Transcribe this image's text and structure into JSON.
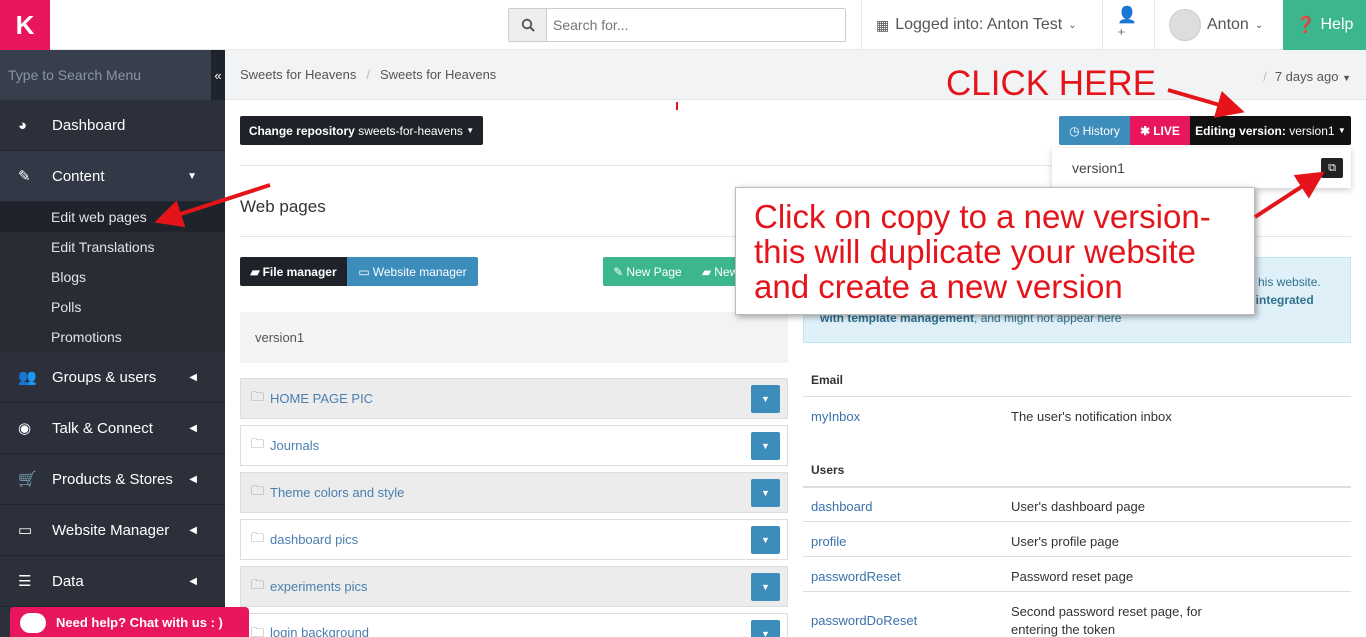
{
  "topbar": {
    "logo": "K",
    "search_placeholder": "Search for...",
    "logged_into": "Logged into: Anton Test",
    "user": "Anton",
    "help": "Help"
  },
  "sidebar": {
    "search_placeholder": "Type to Search Menu",
    "collapse": "«",
    "items": [
      {
        "label": "Dashboard",
        "icon": "dashboard-icon"
      },
      {
        "label": "Content",
        "icon": "edit-icon"
      },
      {
        "label": "Groups & users",
        "icon": "users-icon"
      },
      {
        "label": "Talk & Connect",
        "icon": "rss-icon"
      },
      {
        "label": "Products & Stores",
        "icon": "cart-icon"
      },
      {
        "label": "Website Manager",
        "icon": "monitor-icon"
      },
      {
        "label": "Data",
        "icon": "database-icon"
      }
    ],
    "content_sub": [
      "Edit web pages",
      "Edit Translations",
      "Blogs",
      "Polls",
      "Promotions"
    ]
  },
  "breadcrumb": {
    "items": [
      "Sweets for Heavens",
      "Sweets for Heavens"
    ],
    "ago": "7 days ago"
  },
  "toolbar": {
    "change_repo_prefix": "Change repository",
    "change_repo_value": "sweets-for-heavens",
    "history": "History",
    "live": "LIVE",
    "editing_prefix": "Editing version:",
    "editing_value": "version1"
  },
  "version_dropdown": {
    "item": "version1"
  },
  "main": {
    "title": "Web pages",
    "file_manager": "File manager",
    "website_manager": "Website manager",
    "new_page": "New Page",
    "new_folder": "New",
    "repo_label": "version1",
    "folders": [
      "HOME PAGE PIC",
      "Journals",
      "Theme colors and style",
      "dashboard pics",
      "experiments pics",
      "login background"
    ]
  },
  "info": {
    "line1": "his website.",
    "line2": "re integrated",
    "line3a": "with template management",
    "line3b": ", and might not appear here"
  },
  "table": {
    "groups": [
      {
        "header": "Email",
        "rows": [
          {
            "k": "myInbox",
            "v": "The user's notification inbox"
          }
        ]
      },
      {
        "header": "Users",
        "rows": [
          {
            "k": "dashboard",
            "v": "User's dashboard page"
          },
          {
            "k": "profile",
            "v": "User's profile page"
          },
          {
            "k": "passwordReset",
            "v": "Password reset page"
          },
          {
            "k": "passwordDoReset",
            "v": "Second password reset page, for entering the token"
          }
        ]
      }
    ]
  },
  "annotations": {
    "click_here": "CLICK HERE",
    "callout": "Click on copy to a new version- this will duplicate your website and create a new version"
  },
  "chat": {
    "label": "Need help? Chat with us : )"
  },
  "colors": {
    "brand": "#e8175d",
    "help": "#3cb68f",
    "sidebar": "#2b303b",
    "annotation": "#e5141a",
    "primary": "#3c8dbc"
  }
}
